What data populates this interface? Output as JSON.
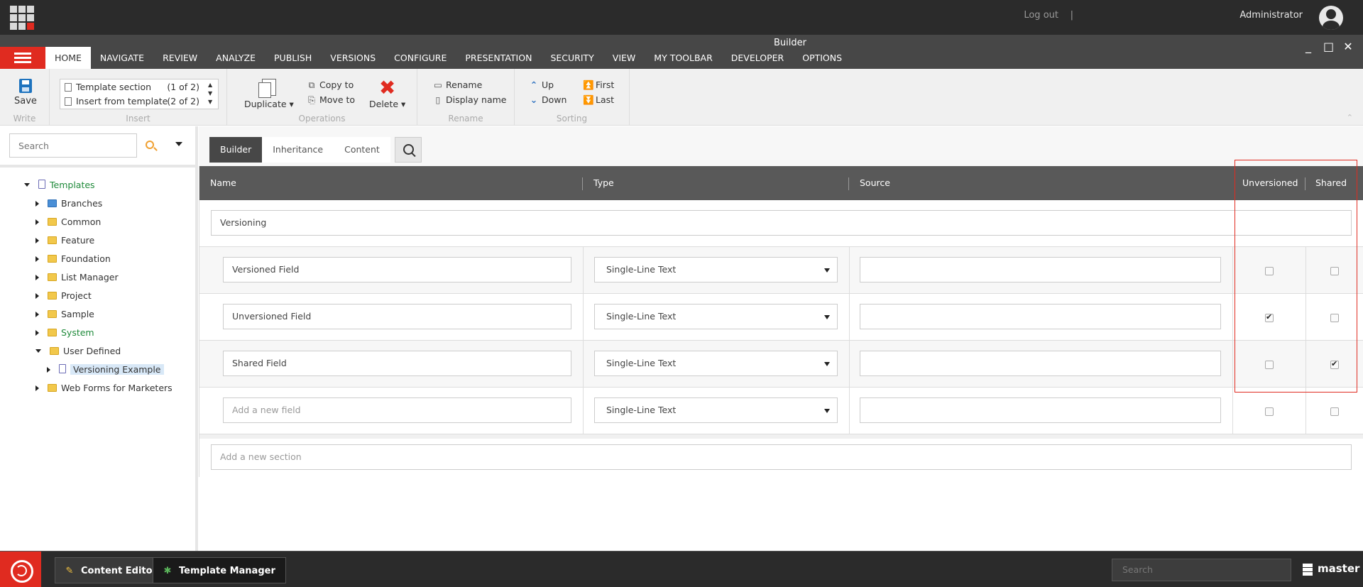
{
  "topbar": {
    "logout": "Log out",
    "separator": "|",
    "user": "Administrator"
  },
  "window": {
    "title": "Builder",
    "minimize": "_",
    "maximize": "□",
    "close": "✕"
  },
  "ribbon_tabs": [
    "HOME",
    "NAVIGATE",
    "REVIEW",
    "ANALYZE",
    "PUBLISH",
    "VERSIONS",
    "CONFIGURE",
    "PRESENTATION",
    "SECURITY",
    "VIEW",
    "MY TOOLBAR",
    "DEVELOPER",
    "OPTIONS"
  ],
  "ribbon": {
    "write": {
      "save": "Save",
      "label": "Write"
    },
    "insert": {
      "label": "Insert",
      "items": [
        {
          "name": "Template section",
          "count": "(1 of 2)"
        },
        {
          "name": "Insert from template",
          "count": "(2 of 2)"
        }
      ]
    },
    "operations": {
      "label": "Operations",
      "duplicate": "Duplicate",
      "copy_to": "Copy to",
      "move_to": "Move to",
      "delete": "Delete"
    },
    "rename": {
      "label": "Rename",
      "rename": "Rename",
      "display_name": "Display name"
    },
    "sorting": {
      "label": "Sorting",
      "up": "Up",
      "down": "Down",
      "first": "First",
      "last": "Last"
    }
  },
  "tree": {
    "search_placeholder": "Search",
    "items": [
      {
        "label": "Templates",
        "level": 0,
        "open": true,
        "icon": "doc",
        "green": true
      },
      {
        "label": "Branches",
        "level": 1,
        "icon": "branch"
      },
      {
        "label": "Common",
        "level": 1,
        "icon": "folder"
      },
      {
        "label": "Feature",
        "level": 1,
        "icon": "folder"
      },
      {
        "label": "Foundation",
        "level": 1,
        "icon": "folder"
      },
      {
        "label": "List Manager",
        "level": 1,
        "icon": "folder"
      },
      {
        "label": "Project",
        "level": 1,
        "icon": "folder"
      },
      {
        "label": "Sample",
        "level": 1,
        "icon": "folder"
      },
      {
        "label": "System",
        "level": 1,
        "icon": "folder",
        "green": true
      },
      {
        "label": "User Defined",
        "level": 1,
        "open": true,
        "icon": "folder"
      },
      {
        "label": "Versioning Example",
        "level": 2,
        "icon": "doc",
        "selected": true
      },
      {
        "label": "Web Forms for Marketers",
        "level": 1,
        "icon": "folder"
      }
    ]
  },
  "subtabs": [
    "Builder",
    "Inheritance",
    "Content"
  ],
  "grid": {
    "headers": {
      "name": "Name",
      "type": "Type",
      "source": "Source",
      "unversioned": "Unversioned",
      "shared": "Shared"
    },
    "section": "Versioning",
    "fields": [
      {
        "name": "Versioned Field",
        "type": "Single-Line Text",
        "unversioned": false,
        "shared": false
      },
      {
        "name": "Unversioned Field",
        "type": "Single-Line Text",
        "unversioned": true,
        "shared": false
      },
      {
        "name": "Shared Field",
        "type": "Single-Line Text",
        "unversioned": false,
        "shared": true
      }
    ],
    "new_field": {
      "placeholder": "Add a new field",
      "type": "Single-Line Text"
    },
    "new_section_placeholder": "Add a new section"
  },
  "taskbar": {
    "buttons": [
      "Content Editor",
      "Template Manager"
    ],
    "search_placeholder": "Search",
    "database": "master"
  },
  "colors": {
    "accent": "#e02b20",
    "dark": "#2b2b2b",
    "tree_green": "#1f8a3a"
  }
}
